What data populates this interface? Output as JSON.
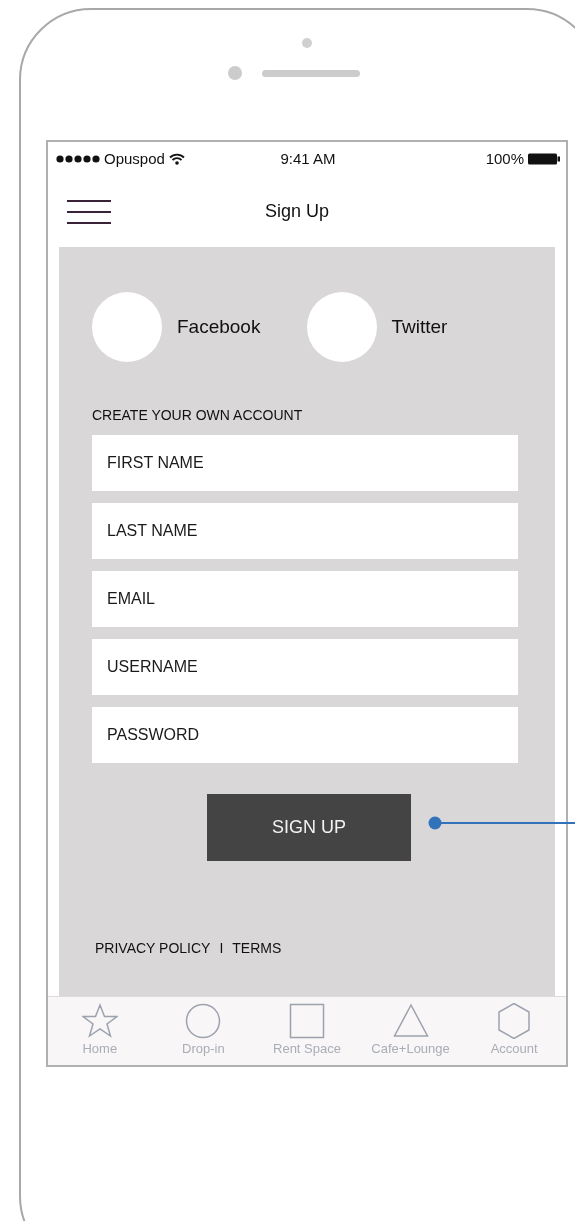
{
  "status_bar": {
    "carrier": "Opuspod",
    "time": "9:41 AM",
    "battery": "100%"
  },
  "nav": {
    "title": "Sign Up"
  },
  "social": [
    {
      "label": "Facebook"
    },
    {
      "label": "Twitter"
    }
  ],
  "form": {
    "heading": "CREATE YOUR OWN ACCOUNT",
    "fields": [
      {
        "placeholder": "FIRST NAME"
      },
      {
        "placeholder": "LAST NAME"
      },
      {
        "placeholder": "EMAIL"
      },
      {
        "placeholder": "USERNAME"
      },
      {
        "placeholder": "PASSWORD"
      }
    ],
    "submit": "SIGN UP"
  },
  "footer": {
    "links": [
      "PRIVACY POLICY",
      "TERMS"
    ],
    "separator": "I"
  },
  "tab_bar": [
    {
      "label": "Home",
      "kind": "star"
    },
    {
      "label": "Drop-in",
      "kind": "circle"
    },
    {
      "label": "Rent Space",
      "kind": "square"
    },
    {
      "label": "Cafe+Lounge",
      "kind": "triangle"
    },
    {
      "label": "Account",
      "kind": "hexagon"
    }
  ]
}
